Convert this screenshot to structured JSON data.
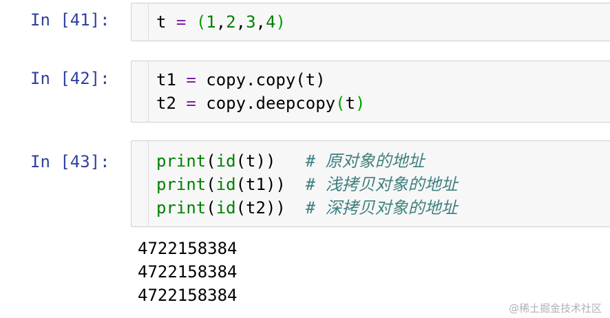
{
  "cells": [
    {
      "prompt": "In [41]:",
      "lines": [
        [
          {
            "t": "t ",
            "c": ""
          },
          {
            "t": "=",
            "c": "kw"
          },
          {
            "t": " ",
            "c": ""
          },
          {
            "t": "(",
            "c": "par-g"
          },
          {
            "t": "1",
            "c": "num"
          },
          {
            "t": ",",
            "c": ""
          },
          {
            "t": "2",
            "c": "num"
          },
          {
            "t": ",",
            "c": ""
          },
          {
            "t": "3",
            "c": "num"
          },
          {
            "t": ",",
            "c": ""
          },
          {
            "t": "4",
            "c": "num"
          },
          {
            "t": ")",
            "c": "par-g"
          }
        ]
      ]
    },
    {
      "prompt": "In [42]:",
      "lines": [
        [
          {
            "t": "t1 ",
            "c": ""
          },
          {
            "t": "=",
            "c": "kw"
          },
          {
            "t": " copy.copy(t)",
            "c": ""
          }
        ],
        [
          {
            "t": "t2 ",
            "c": ""
          },
          {
            "t": "=",
            "c": "kw"
          },
          {
            "t": " copy.deepcopy",
            "c": ""
          },
          {
            "t": "(",
            "c": "par-g"
          },
          {
            "t": "t",
            "c": ""
          },
          {
            "t": ")",
            "c": "par-g"
          }
        ]
      ]
    },
    {
      "prompt": "In [43]:",
      "lines": [
        [
          {
            "t": "print",
            "c": "bi"
          },
          {
            "t": "(",
            "c": ""
          },
          {
            "t": "id",
            "c": "bi"
          },
          {
            "t": "(t))   ",
            "c": ""
          },
          {
            "t": "# 原对象的地址",
            "c": "cm"
          }
        ],
        [
          {
            "t": "print",
            "c": "bi"
          },
          {
            "t": "(",
            "c": ""
          },
          {
            "t": "id",
            "c": "bi"
          },
          {
            "t": "(t1))  ",
            "c": ""
          },
          {
            "t": "# 浅拷贝对象的地址",
            "c": "cm"
          }
        ],
        [
          {
            "t": "print",
            "c": "bi"
          },
          {
            "t": "(",
            "c": ""
          },
          {
            "t": "id",
            "c": "bi"
          },
          {
            "t": "(t2))  ",
            "c": ""
          },
          {
            "t": "# 深拷贝对象的地址",
            "c": "cm"
          }
        ]
      ],
      "output": [
        "4722158384",
        "4722158384",
        "4722158384"
      ]
    }
  ],
  "watermark": "@稀土掘金技术社区"
}
